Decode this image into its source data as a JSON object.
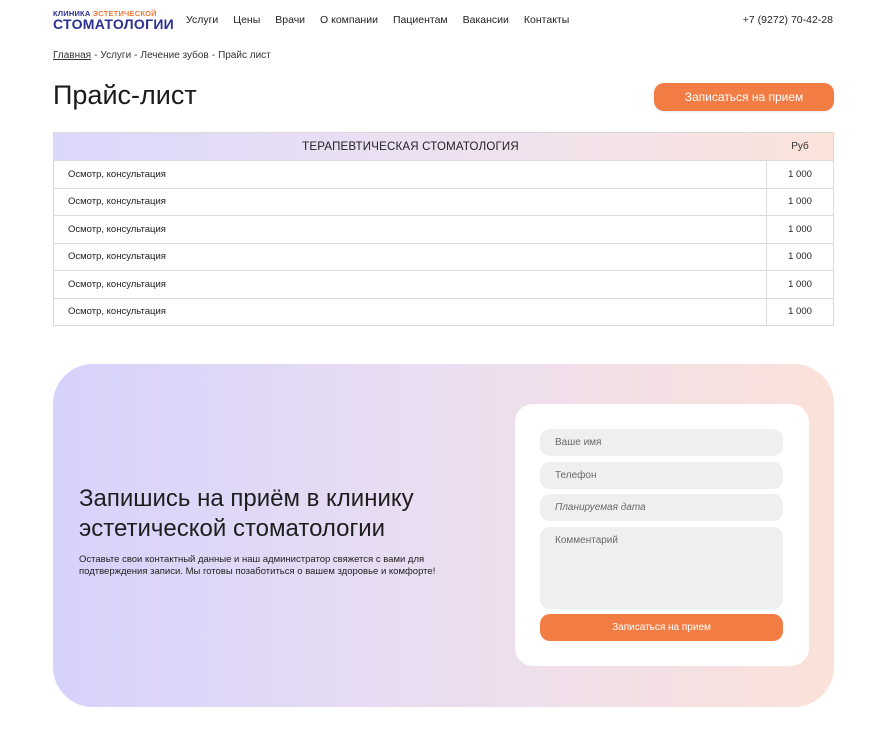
{
  "header": {
    "logo": {
      "line1_a": "КЛИНИКА",
      "line1_b": "ЭСТЕТИЧЕСКОЙ",
      "line2": "СТОМАТОЛОГИИ"
    },
    "nav": [
      "Услуги",
      "Цены",
      "Врачи",
      "О компании",
      "Пациентам",
      "Вакансии",
      "Контакты"
    ],
    "phone": "+7 (9272) 70-42-28"
  },
  "breadcrumb": {
    "items": [
      "Главная",
      "Услуги",
      "Лечение зубов",
      "Прайс лист"
    ],
    "separator": "-"
  },
  "page": {
    "title": "Прайс-лист",
    "book_button": "Записаться на прием"
  },
  "price_table": {
    "section_title": "ТЕРАПЕВТИЧЕСКАЯ СТОМАТОЛОГИЯ",
    "price_header": "Руб",
    "rows": [
      {
        "name": "Осмотр, консультация",
        "price": "1 000"
      },
      {
        "name": "Осмотр, консультация",
        "price": "1 000"
      },
      {
        "name": "Осмотр, консультация",
        "price": "1 000"
      },
      {
        "name": "Осмотр, консультация",
        "price": "1 000"
      },
      {
        "name": "Осмотр, консультация",
        "price": "1 000"
      },
      {
        "name": "Осмотр, консультация",
        "price": "1 000"
      }
    ]
  },
  "booking": {
    "title": "Запишись на приём в клинику эстетической стоматологии",
    "text": "Оставьте свои контактный данные и наш администратор свяжется с вами для подтверждения записи. Мы готовы позаботиться о вашем здоровье и комфорте!",
    "form": {
      "name_placeholder": "Ваше имя",
      "phone_placeholder": "Телефон",
      "date_placeholder": "Планируемая дата",
      "comment_placeholder": "Комментарий",
      "submit_label": "Записаться на прием"
    }
  },
  "colors": {
    "accent": "#f27d44",
    "brand_blue": "#2b2f8f",
    "gradient_start": "#d6d2fb",
    "gradient_end": "#fbe2d9"
  }
}
